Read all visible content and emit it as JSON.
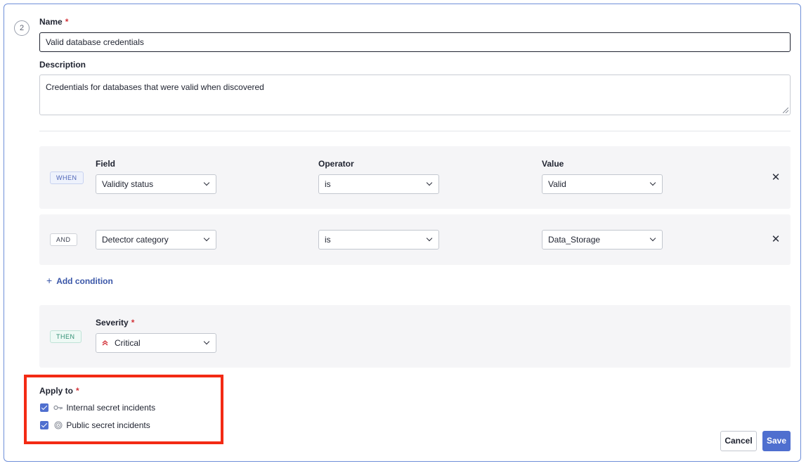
{
  "step_number": "2",
  "name": {
    "label": "Name",
    "required": "*",
    "value": "Valid database credentials"
  },
  "description": {
    "label": "Description",
    "value": "Credentials for databases that were valid when discovered"
  },
  "columns": {
    "field": "Field",
    "operator": "Operator",
    "value": "Value"
  },
  "conditions": [
    {
      "tag": "WHEN",
      "field": "Validity status",
      "operator": "is",
      "value": "Valid"
    },
    {
      "tag": "AND",
      "field": "Detector category",
      "operator": "is",
      "value": "Data_Storage"
    }
  ],
  "add_condition": "Add condition",
  "then": {
    "tag": "THEN",
    "severity_label": "Severity",
    "required": "*",
    "severity_value": "Critical",
    "severity_icon": "double-chevron-up-icon",
    "severity_color": "#d3333a"
  },
  "apply_to": {
    "label": "Apply to",
    "required": "*",
    "options": [
      {
        "label": "Internal secret incidents",
        "checked": true,
        "icon": "key-icon"
      },
      {
        "label": "Public secret incidents",
        "checked": true,
        "icon": "radar-icon"
      }
    ]
  },
  "buttons": {
    "cancel": "Cancel",
    "save": "Save"
  },
  "colors": {
    "accent": "#4f6fcf",
    "highlight": "#f32a14",
    "card_border": "#6f8fd8"
  }
}
